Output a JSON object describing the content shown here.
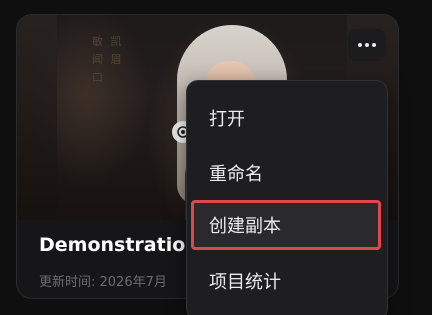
{
  "card": {
    "title": "Demonstration",
    "meta": "更新时间: 2026年7月"
  },
  "thumb": {
    "glyphs": "敏 凯 闻 眉 口"
  },
  "menu": {
    "items": [
      {
        "label": "打开"
      },
      {
        "label": "重命名"
      },
      {
        "label": "创建副本"
      },
      {
        "label": "项目统计"
      }
    ]
  },
  "colors": {
    "background": "#0f0f10",
    "card": "#161618",
    "menu": "#1e1e20",
    "highlight_border": "#e0464c",
    "text": "#ececec",
    "muted": "#6c6c70"
  },
  "icons": {
    "more": "more-horizontal-icon",
    "preview": "eye-icon"
  }
}
